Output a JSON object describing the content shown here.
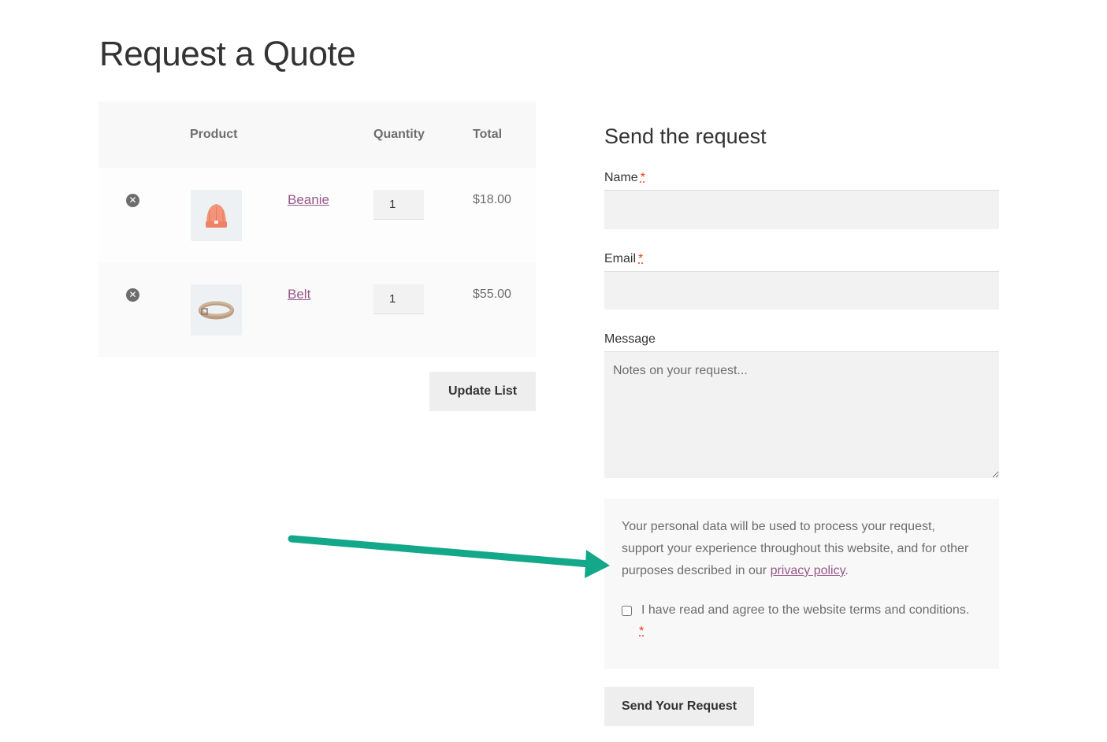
{
  "page": {
    "title": "Request a Quote"
  },
  "table": {
    "headers": {
      "product": "Product",
      "quantity": "Quantity",
      "total": "Total"
    },
    "rows": [
      {
        "name": "Beanie",
        "quantity": "1",
        "total": "$18.00",
        "image_icon": "beanie-image"
      },
      {
        "name": "Belt",
        "quantity": "1",
        "total": "$55.00",
        "image_icon": "belt-image"
      }
    ],
    "remove_glyph": "✕",
    "update_label": "Update List"
  },
  "form": {
    "title": "Send the request",
    "name_label": "Name",
    "email_label": "Email",
    "message_label": "Message",
    "message_placeholder": "Notes on your request...",
    "required_mark": "*",
    "privacy_text": "Your personal data will be used to process your request, support your experience throughout this website, and for other purposes described in our",
    "privacy_link": "privacy policy",
    "privacy_period": ".",
    "terms_label": "I have read and agree to the website terms and conditions.",
    "send_label": "Send Your Request"
  },
  "colors": {
    "accent_link": "#96588a",
    "required": "#e2401c",
    "arrow": "#13a88a"
  }
}
